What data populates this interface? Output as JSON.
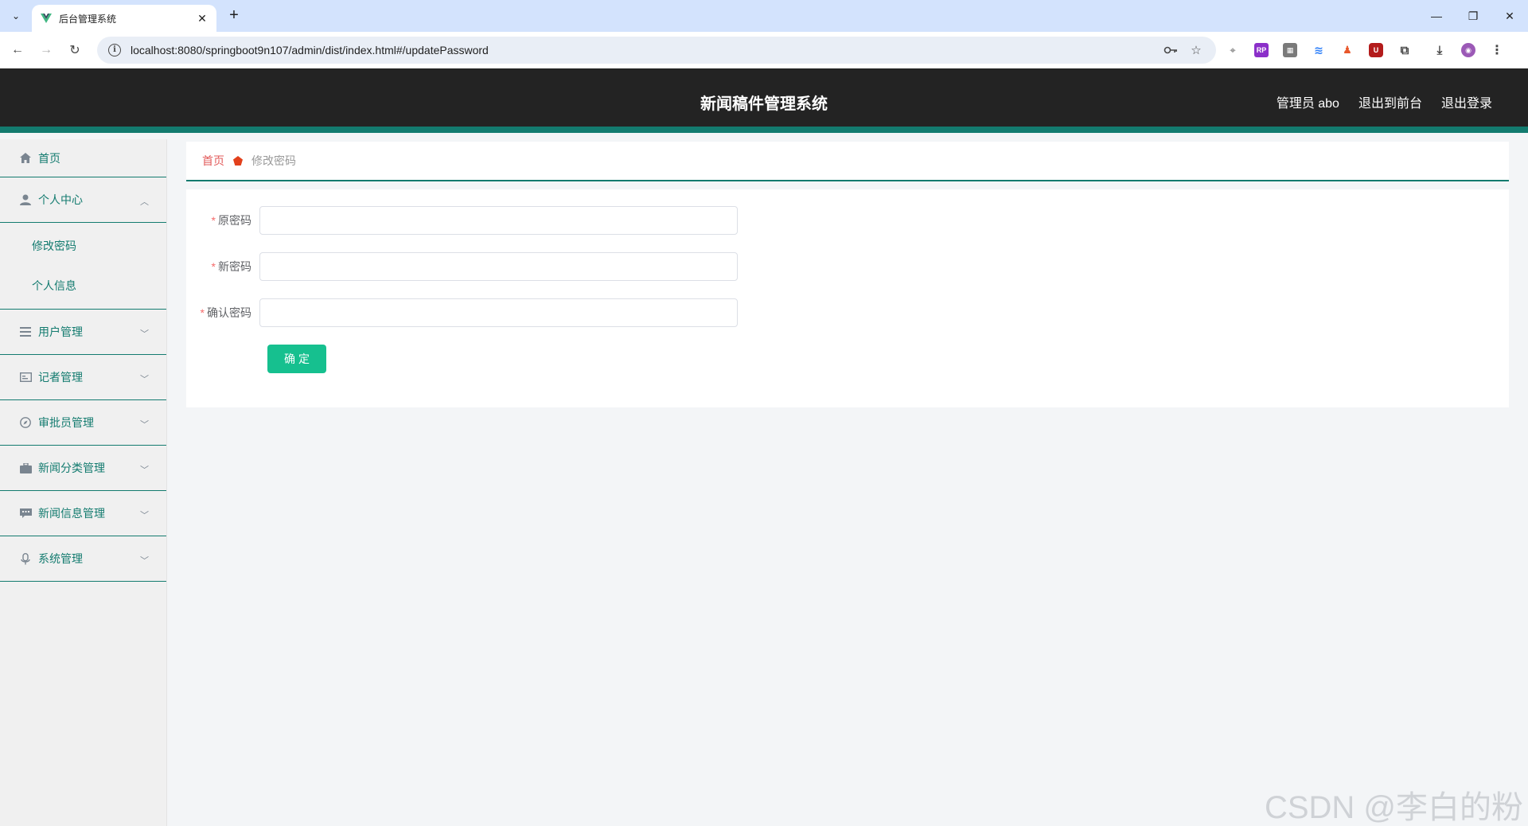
{
  "browser": {
    "tab_title": "后台管理系统",
    "url": "localhost:8080/springboot9n107/admin/dist/index.html#/updatePassword"
  },
  "header": {
    "title": "新闻稿件管理系统",
    "user_label": "管理员 abo",
    "front_label": "退出到前台",
    "logout_label": "退出登录",
    "bg_color": "#232323",
    "accent_color": "#137b6f"
  },
  "sidebar": {
    "home": "首页",
    "personal": {
      "label": "个人中心",
      "items": [
        "修改密码",
        "个人信息"
      ]
    },
    "groups": [
      {
        "label": "用户管理",
        "icon": "list-icon"
      },
      {
        "label": "记者管理",
        "icon": "id-card-icon"
      },
      {
        "label": "审批员管理",
        "icon": "compass-icon"
      },
      {
        "label": "新闻分类管理",
        "icon": "briefcase-icon"
      },
      {
        "label": "新闻信息管理",
        "icon": "chat-icon"
      },
      {
        "label": "系统管理",
        "icon": "mic-icon"
      }
    ]
  },
  "breadcrumb": {
    "home": "首页",
    "current": "修改密码"
  },
  "form": {
    "old_password_label": "原密码",
    "new_password_label": "新密码",
    "confirm_password_label": "确认密码",
    "submit_label": "确定",
    "button_color": "#16c08f"
  },
  "watermark": "CSDN @李白的粉"
}
